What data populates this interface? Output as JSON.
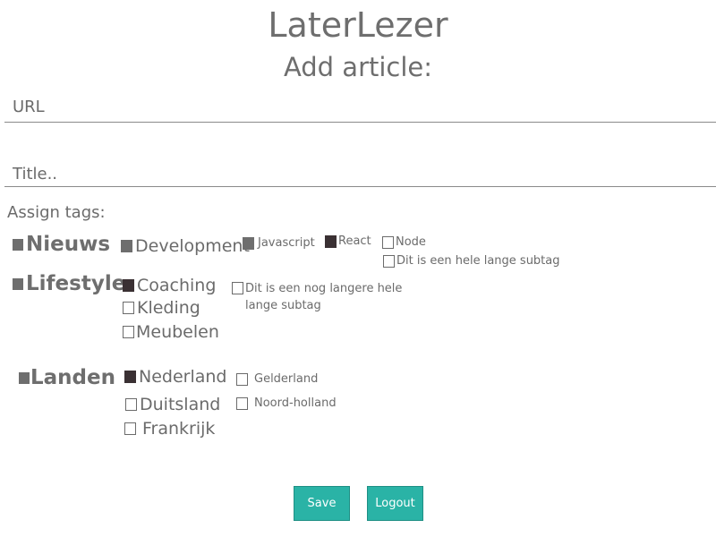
{
  "app": {
    "title": "LaterLezer"
  },
  "form": {
    "heading": "Add article:",
    "url_placeholder": "URL",
    "title_placeholder": "Title..",
    "tags_label": "Assign tags:"
  },
  "tags": {
    "nieuws": "Nieuws",
    "development": "Development",
    "javascript": "Javascript",
    "react": "React",
    "node": "Node",
    "long_subtag": "Dit is een hele lange subtag",
    "lifestyle": "Lifestyle",
    "coaching": "Coaching",
    "kleding": "Kleding",
    "meubelen": "Meubelen",
    "longer_subtag": "Dit is een nog langere hele lange subtag",
    "landen": "Landen",
    "nederland": "Nederland",
    "duitsland": "Duitsland",
    "frankrijk": "Frankrijk",
    "gelderland": "Gelderland",
    "noord_holland": "Noord-holland"
  },
  "buttons": {
    "save": "Save",
    "logout": "Logout"
  },
  "colors": {
    "accent": "#2ab3a6",
    "text": "#6b6b6b",
    "checked": "#3a3033"
  }
}
